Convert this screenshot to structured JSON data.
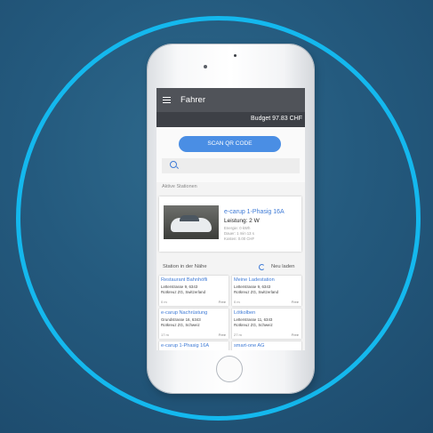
{
  "app": {
    "title": "Fahrer",
    "budget": "Budget 97.83 CHF"
  },
  "scan": {
    "button_label": "SCAN QR CODE",
    "search_placeholder": ""
  },
  "active_section": {
    "label": "Aktive Stationen",
    "card": {
      "title": "e-carup 1-Phasig 16A",
      "power": "Leistung: 2 W",
      "energy": "Energie: 0 kWh",
      "duration": "Dauer: 1 min 13 s",
      "cost": "Kosten: 0.00 CHF"
    }
  },
  "nearby": {
    "label": "Station in der Nähe",
    "refresh_label": "Neu laden",
    "stations": [
      {
        "name": "Restaurant Bahnhöfli",
        "street": "Letterstrasse 9, 6343",
        "city": "Rotkreuz ZG, Switzerland",
        "distance": "0 m",
        "status": "Free"
      },
      {
        "name": "Meine Ladestation",
        "street": "Letterstrasse 9, 6343",
        "city": "Rotkreuz ZG, Switzerland",
        "distance": "0 m",
        "status": "Free"
      },
      {
        "name": "e-carup Nachrüstung",
        "street": "Grundstrasse 16, 6343",
        "city": "Rotkreuz ZG, Schweiz",
        "distance": "17 m",
        "status": "Free"
      },
      {
        "name": "Lötkolben",
        "street": "Letterstrasse 11, 6343",
        "city": "Rotkreuz ZG, Schweiz",
        "distance": "27 m",
        "status": "Free"
      },
      {
        "name": "e-carup 1-Phasig 16A",
        "street": "",
        "city": "",
        "distance": "",
        "status": ""
      },
      {
        "name": "smart-one AG",
        "street": "",
        "city": "",
        "distance": "",
        "status": ""
      }
    ]
  },
  "colors": {
    "accent": "#4a8ee4",
    "ring": "#14b8ee",
    "appbar": "#505359",
    "background": "#245a7e"
  }
}
